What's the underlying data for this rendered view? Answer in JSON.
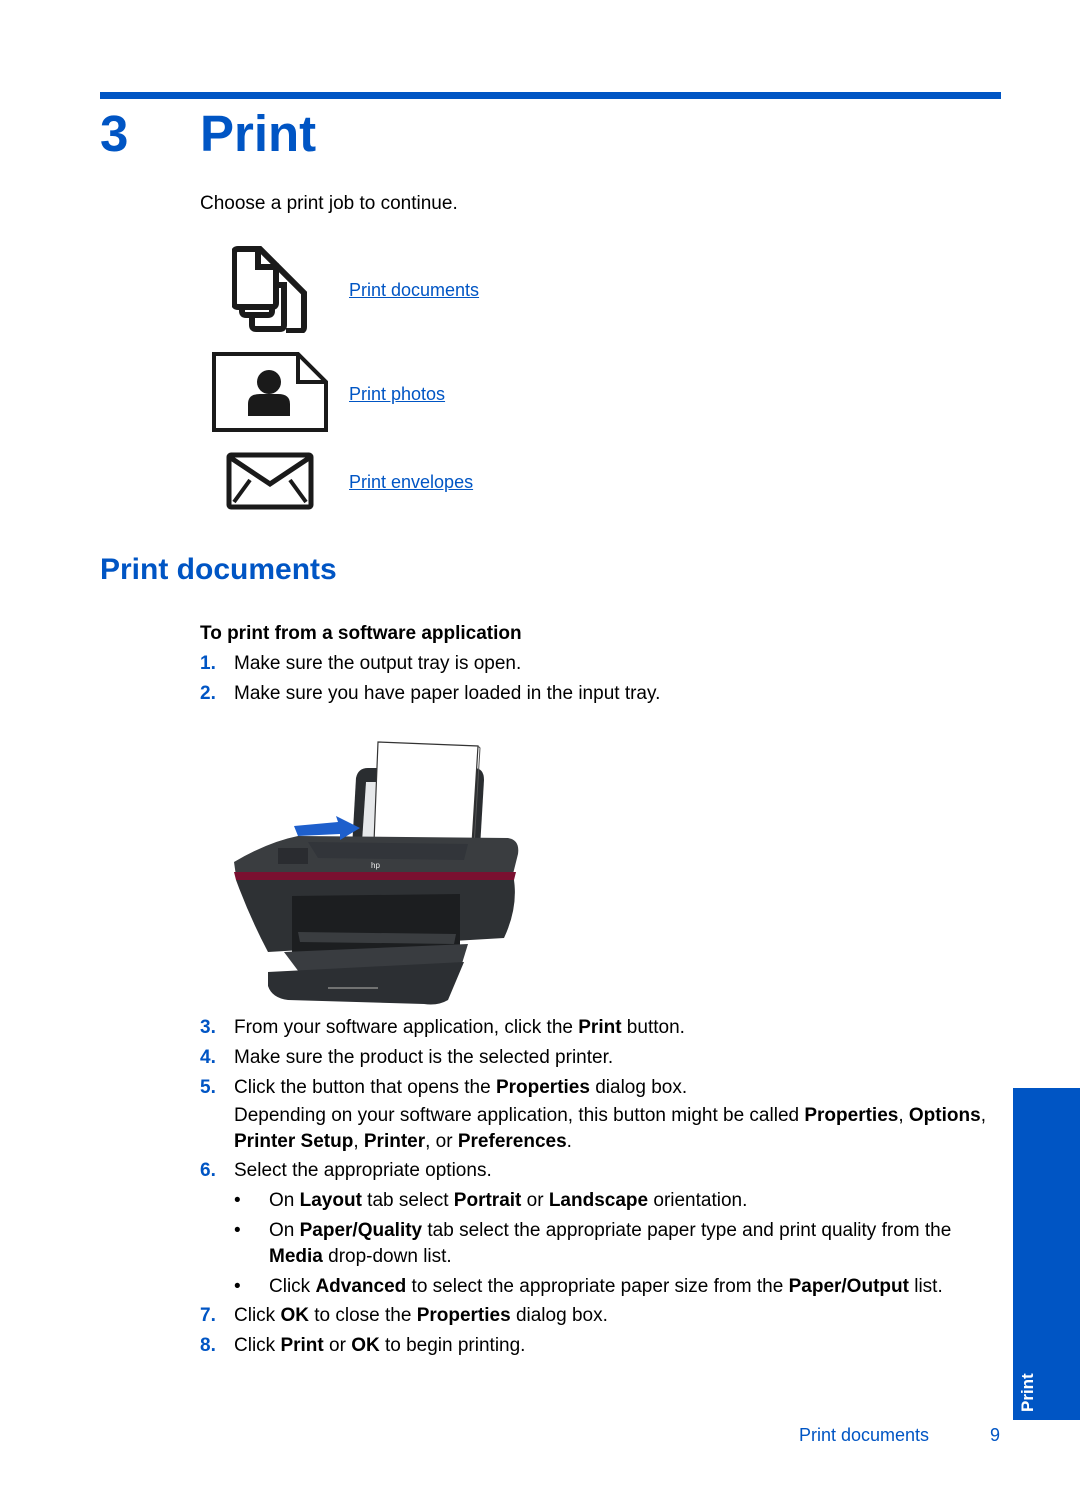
{
  "chapter": {
    "number": "3",
    "title": "Print"
  },
  "intro": "Choose a print job to continue.",
  "print_jobs": [
    {
      "icon": "documents-icon",
      "label": "Print documents"
    },
    {
      "icon": "photo-icon",
      "label": "Print photos"
    },
    {
      "icon": "envelope-icon",
      "label": "Print envelopes"
    }
  ],
  "section": {
    "title": "Print documents",
    "procedure_title": "To print from a software application",
    "steps": [
      {
        "num": "1.",
        "text": "Make sure the output tray is open."
      },
      {
        "num": "2.",
        "text": "Make sure you have paper loaded in the input tray."
      },
      {
        "num": "3.",
        "pre": "From your software application, click the ",
        "b1": "Print",
        "post": " button."
      },
      {
        "num": "4.",
        "text": "Make sure the product is the selected printer."
      },
      {
        "num": "5.",
        "pre": "Click the button that opens the ",
        "b1": "Properties",
        "post": " dialog box."
      },
      {
        "num": "6.",
        "text": "Select the appropriate options."
      },
      {
        "num": "7.",
        "pre": "Click ",
        "b1": "OK",
        "mid": " to close the ",
        "b2": "Properties",
        "post": " dialog box."
      },
      {
        "num": "8.",
        "pre": "Click ",
        "b1": "Print",
        "mid": " or ",
        "b2": "OK",
        "post": " to begin printing."
      }
    ],
    "step5_note": {
      "pre": "Depending on your software application, this button might be called ",
      "b1": "Properties",
      "s1": ", ",
      "b2": "Options",
      "s2": ", ",
      "b3": "Printer Setup",
      "s3": ", ",
      "b4": "Printer",
      "s4": ", or ",
      "b5": "Preferences",
      "post": "."
    },
    "bullets": [
      {
        "pre": "On ",
        "b1": "Layout",
        "m1": " tab select ",
        "b2": "Portrait",
        "m2": " or ",
        "b3": "Landscape",
        "post": " orientation."
      },
      {
        "pre": "On ",
        "b1": "Paper/Quality",
        "m1": " tab select the appropriate paper type and print quality from the ",
        "b2": "Media",
        "post": " drop-down list."
      },
      {
        "pre": "Click ",
        "b1": "Advanced",
        "m1": " to select the appropriate paper size from the ",
        "b2": "Paper/Output",
        "post": " list."
      }
    ],
    "bullet_char": "•"
  },
  "side_tab": "Print",
  "footer": {
    "section": "Print documents",
    "page": "9"
  },
  "colors": {
    "accent": "#0055c4",
    "printer_trim": "#7a1030"
  }
}
